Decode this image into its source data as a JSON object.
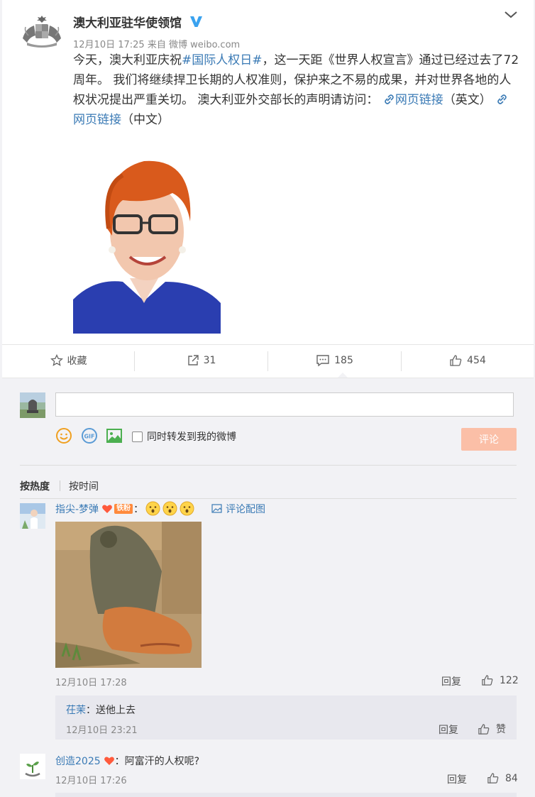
{
  "post": {
    "author": "澳大利亚驻华使领馆",
    "meta": "12月10日 17:25 来自 微博 weibo.com",
    "text_before": "今天，澳大利亚庆祝",
    "hashtag": "#国际人权日#",
    "text_after": "，这一天距《世界人权宣言》通过已经过去了72周年。 我们将继续捍卫长期的人权准则，保护来之不易的成果，并对世界各地的人权状况提出严重关切。 澳大利亚外交部长的声明请访问： ",
    "link1": "网页链接",
    "link1_suffix": "（英文）",
    "link2": "网页链接",
    "link2_suffix": "（中文）"
  },
  "actions": {
    "favorite": "收藏",
    "repost": "31",
    "comment": "185",
    "like": "454"
  },
  "compose": {
    "placeholder": "",
    "repost_checkbox": "同时转发到我的微博",
    "submit": "评论"
  },
  "sort": {
    "by_heat": "按热度",
    "by_time": "按时间"
  },
  "comments": [
    {
      "name": "指尖-梦弹",
      "badge": "铁粉",
      "colon": "：",
      "pic_link": "评论配图",
      "time": "12月10日 17:28",
      "reply": "回复",
      "likes": "122",
      "sub": {
        "name": "茌茉",
        "text": "：送他上去",
        "time": "12月10日 23:21",
        "reply": "回复",
        "like": "赞"
      }
    },
    {
      "name": "创造2025",
      "text": "：阿富汗的人权呢?",
      "time": "12月10日 17:26",
      "reply": "回复",
      "likes": "84"
    }
  ],
  "colors": {
    "link": "#3a7ab5",
    "submit_bg": "#fbbfa7",
    "badge": "#ff8a3c",
    "page_bg": "#f2f2f5"
  }
}
